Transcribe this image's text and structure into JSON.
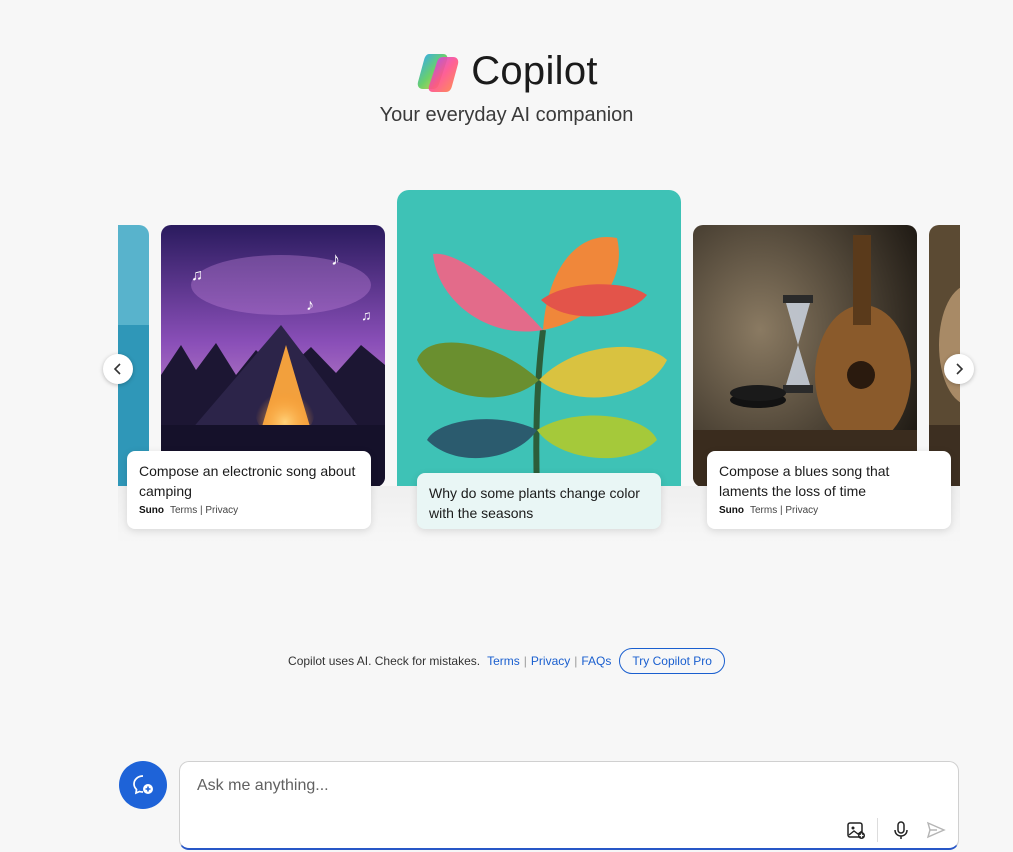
{
  "header": {
    "app_name": "Copilot",
    "tagline": "Your everyday AI companion"
  },
  "carousel": {
    "cards": [
      {
        "prompt": "Compose an electronic song about camping",
        "brand": "Suno",
        "terms": "Terms",
        "privacy": "Privacy"
      },
      {
        "prompt": "Why do some plants change color with the seasons"
      },
      {
        "prompt": "Compose a blues song that laments the loss of time",
        "brand": "Suno",
        "terms": "Terms",
        "privacy": "Privacy"
      }
    ],
    "prev_icon": "chevron-left-icon",
    "next_icon": "chevron-right-icon"
  },
  "footer": {
    "disclaimer": "Copilot uses AI. Check for mistakes.",
    "links": [
      "Terms",
      "Privacy",
      "FAQs"
    ],
    "pro_button": "Try Copilot Pro"
  },
  "composer": {
    "placeholder": "Ask me anything...",
    "new_chat_icon": "new-chat-icon",
    "tools": [
      "image-upload-icon",
      "microphone-icon",
      "send-icon"
    ]
  },
  "colors": {
    "accent": "#1e63d8",
    "link": "#1a5fcf",
    "background": "#f7f7f7"
  }
}
